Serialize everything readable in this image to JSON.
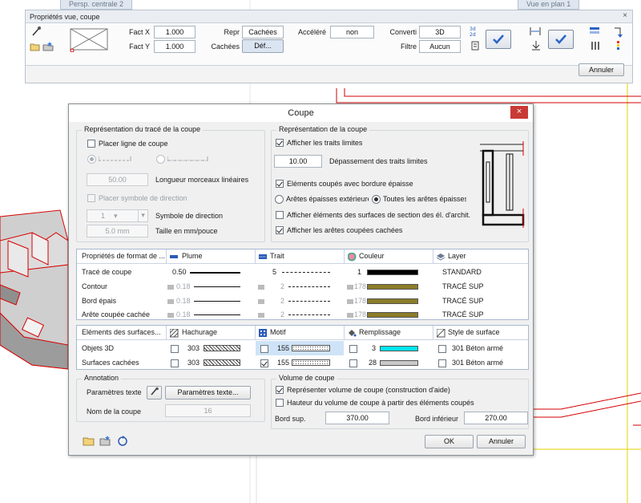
{
  "tabs": {
    "left": "Persp. centrale 2",
    "right": "Vue en plan 1"
  },
  "view_props": {
    "title": "Propriétés vue, coupe",
    "close": "×",
    "fact_x_label": "Fact X",
    "fact_x": "1.000",
    "fact_y_label": "Fact Y",
    "fact_y": "1.000",
    "repr_label": "Repr",
    "repr_value": "Cachées",
    "cachees_label": "Cachées",
    "def_button": "Déf...",
    "accelere_label": "Accéléré",
    "accelere_value": "non",
    "converti_label": "Converti",
    "converti_value": "3D",
    "filtre_label": "Filtre",
    "filtre_value": "Aucun",
    "annuler": "Annuler"
  },
  "dialog": {
    "title": "Coupe",
    "close": "×",
    "trace": {
      "group": "Représentation du tracé de la coupe",
      "placer_ligne": "Placer ligne de coupe",
      "longueur_value": "50.00",
      "longueur_label": "Longueur morceaux linéaires",
      "placer_symbole": "Placer symbole de direction",
      "symbole_value": "1",
      "symbole_label": "Symbole de direction",
      "taille_value": "5.0 mm",
      "taille_label": "Taille en mm/pouce"
    },
    "coupe": {
      "group": "Représentation de la coupe",
      "afficher_traits": "Afficher les traits limites",
      "depassement_value": "10.00",
      "depassement_label": "Dépassement des traits limites",
      "elements_bordure": "Eléments coupés avec bordure épaisse",
      "aretes_ext": "Arêtes épaisses extérieures",
      "toutes_aretes": "Toutes les arêtes épaisses",
      "afficher_surfaces": "Afficher éléments des surfaces de section des él. d'archit.",
      "afficher_aretes": "Afficher les arêtes coupées cachées"
    },
    "format_table": {
      "headers": [
        "Propriétés de format de ...",
        "Plume",
        "Trait",
        "Couleur",
        "Layer"
      ],
      "rows": [
        {
          "name": "Tracé de coupe",
          "plume": "0.50",
          "trait": "5",
          "couleur": "1",
          "color": "#000000",
          "layer": "STANDARD",
          "disabled": false
        },
        {
          "name": "Contour",
          "plume": "0.18",
          "trait": "2",
          "couleur": "178",
          "color": "#8b7d2a",
          "layer": "TRACÉ SUP",
          "disabled": true
        },
        {
          "name": "Bord épais",
          "plume": "0.18",
          "trait": "2",
          "couleur": "178",
          "color": "#8b7d2a",
          "layer": "TRACÉ SUP",
          "disabled": true
        },
        {
          "name": "Arête coupée cachée",
          "plume": "0.18",
          "trait": "2",
          "couleur": "178",
          "color": "#8b7d2a",
          "layer": "TRACÉ SUP",
          "disabled": true
        }
      ]
    },
    "surface_table": {
      "headers": [
        "Eléments des surfaces...",
        "Hachurage",
        "Motif",
        "Remplissage",
        "Style de surface"
      ],
      "rows": [
        {
          "name": "Objets 3D",
          "hach": "303",
          "motif": "155",
          "rempl": "3",
          "rempl_color": "#00e5f0",
          "style": "301 Béton armé",
          "motif_checked": false
        },
        {
          "name": "Surfaces cachées",
          "hach": "303",
          "motif": "155",
          "rempl": "28",
          "rempl_color": "#c8c8c8",
          "style": "301 Béton armé",
          "motif_checked": true
        }
      ]
    },
    "annotation": {
      "group": "Annotation",
      "param_label": "Paramètres texte",
      "param_button": "Paramètres texte...",
      "nom_label": "Nom de la coupe",
      "nom_value": "16"
    },
    "volume": {
      "group": "Volume de coupe",
      "representer": "Représenter volume de coupe (construction d'aide)",
      "hauteur": "Hauteur du volume de coupe à partir des éléments coupés",
      "bord_sup_label": "Bord sup.",
      "bord_sup": "370.00",
      "bord_inf_label": "Bord inférieur",
      "bord_inf": "270.00"
    },
    "ok": "OK",
    "cancel": "Annuler"
  }
}
